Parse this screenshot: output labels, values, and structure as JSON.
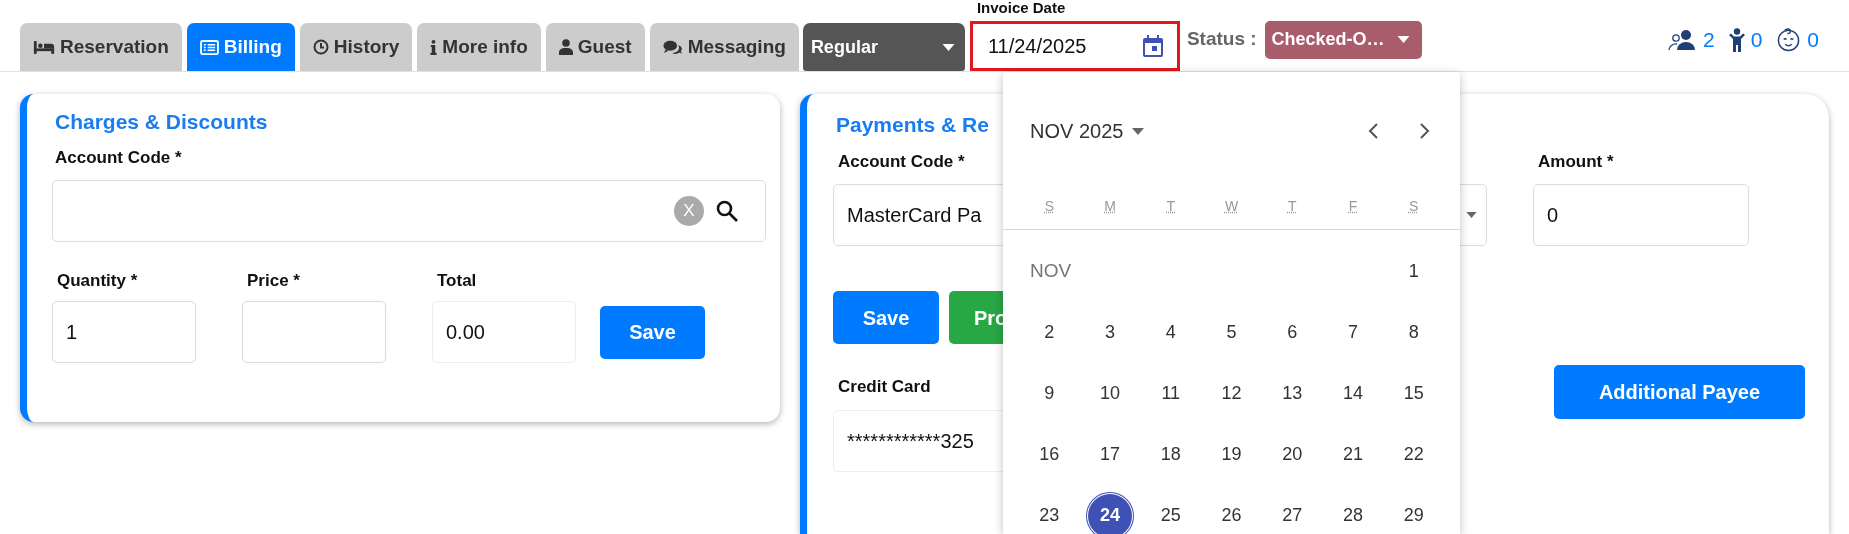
{
  "tabs": [
    {
      "label": "Reservation",
      "selected": false
    },
    {
      "label": "Billing",
      "selected": true
    },
    {
      "label": "History",
      "selected": false
    },
    {
      "label": "More info",
      "selected": false
    },
    {
      "label": "Guest",
      "selected": false
    },
    {
      "label": "Messaging",
      "selected": false
    }
  ],
  "rate_select": {
    "value": "Regular"
  },
  "invoice_date": {
    "label": "Invoice Date",
    "value": "11/24/2025"
  },
  "status": {
    "label": "Status :",
    "value": "Checked-O…"
  },
  "occupancy": [
    {
      "kind": "adults",
      "count": "2"
    },
    {
      "kind": "children",
      "count": "0"
    },
    {
      "kind": "infants",
      "count": "0"
    }
  ],
  "charges_card": {
    "title": "Charges & Discounts",
    "account_code": {
      "label": "Account Code *",
      "clear": "X"
    },
    "quantity": {
      "label": "Quantity *",
      "value": "1"
    },
    "price": {
      "label": "Price *"
    },
    "total": {
      "label": "Total",
      "value": "0.00"
    },
    "save_button": "Save"
  },
  "payments_card": {
    "title": "Payments & Re",
    "account_code": {
      "label": "Account Code *",
      "value": "MasterCard Pa"
    },
    "amount": {
      "label": "Amount *",
      "value": "0"
    },
    "save_button": "Save",
    "second_button": "Pro",
    "credit_card": {
      "label": "Credit Card",
      "value": "************325"
    },
    "additional_payee_button": "Additional Payee"
  },
  "calendar": {
    "month_label": "NOV 2025",
    "weekdays": [
      "S",
      "M",
      "T",
      "W",
      "T",
      "F",
      "S"
    ],
    "month_short": "NOV",
    "weeks": [
      [
        {
          "day": "1",
          "selected": false
        }
      ],
      [
        {
          "day": "2",
          "selected": false
        },
        {
          "day": "3",
          "selected": false
        },
        {
          "day": "4",
          "selected": false
        },
        {
          "day": "5",
          "selected": false
        },
        {
          "day": "6",
          "selected": false
        },
        {
          "day": "7",
          "selected": false
        },
        {
          "day": "8",
          "selected": false
        }
      ],
      [
        {
          "day": "9",
          "selected": false
        },
        {
          "day": "10",
          "selected": false
        },
        {
          "day": "11",
          "selected": false
        },
        {
          "day": "12",
          "selected": false
        },
        {
          "day": "13",
          "selected": false
        },
        {
          "day": "14",
          "selected": false
        },
        {
          "day": "15",
          "selected": false
        }
      ],
      [
        {
          "day": "16",
          "selected": false
        },
        {
          "day": "17",
          "selected": false
        },
        {
          "day": "18",
          "selected": false
        },
        {
          "day": "19",
          "selected": false
        },
        {
          "day": "20",
          "selected": false
        },
        {
          "day": "21",
          "selected": false
        },
        {
          "day": "22",
          "selected": false
        }
      ],
      [
        {
          "day": "23",
          "selected": false
        },
        {
          "day": "24",
          "selected": true
        },
        {
          "day": "25",
          "selected": false
        },
        {
          "day": "26",
          "selected": false
        },
        {
          "day": "27",
          "selected": false
        },
        {
          "day": "28",
          "selected": false
        },
        {
          "day": "29",
          "selected": false
        }
      ]
    ]
  }
}
